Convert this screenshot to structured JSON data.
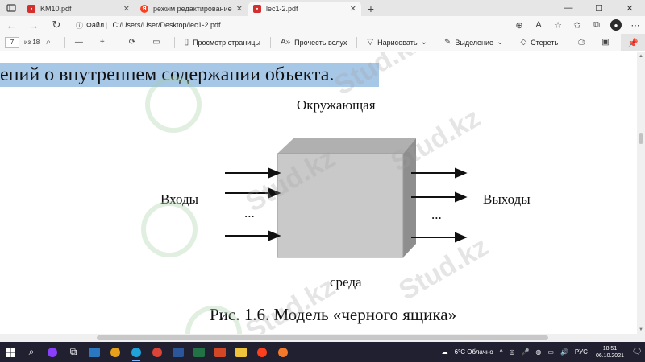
{
  "browser": {
    "tabs": [
      {
        "label": "KM10.pdf",
        "icon": "pdf-icon",
        "active": false
      },
      {
        "label": "режим редактирование гранаа",
        "icon": "yandex-icon",
        "active": false
      },
      {
        "label": "lec1-2.pdf",
        "icon": "pdf-icon",
        "active": true
      }
    ],
    "address": {
      "info_label": "Файл",
      "url": "C:/Users/User/Desktop/lec1-2.pdf"
    }
  },
  "pdf_toolbar": {
    "page_current": "7",
    "page_total": "из 18",
    "page_view": "Просмотр страницы",
    "read_aloud": "Прочесть вслух",
    "draw": "Нарисовать",
    "highlight": "Выделение",
    "erase": "Стереть"
  },
  "document": {
    "highlighted_line": "ений о внутреннем содержании объекта.",
    "label_top": "Окружающая",
    "label_inputs": "Входы",
    "label_outputs": "Выходы",
    "label_bottom": "среда",
    "dots_left": "...",
    "dots_right": "...",
    "caption": "Рис. 1.6. Модель «черного ящика»",
    "watermark": "Stud.kz"
  },
  "taskbar": {
    "weather": "6°C Облачно",
    "language": "РУС",
    "time": "18:51",
    "date": "06.10.2021"
  },
  "colors": {
    "highlight": "#a7c7e7",
    "box_front": "#c9c9c9",
    "box_top": "#b0b0b0",
    "box_side": "#8e8e8e",
    "taskbar": "#202030"
  }
}
